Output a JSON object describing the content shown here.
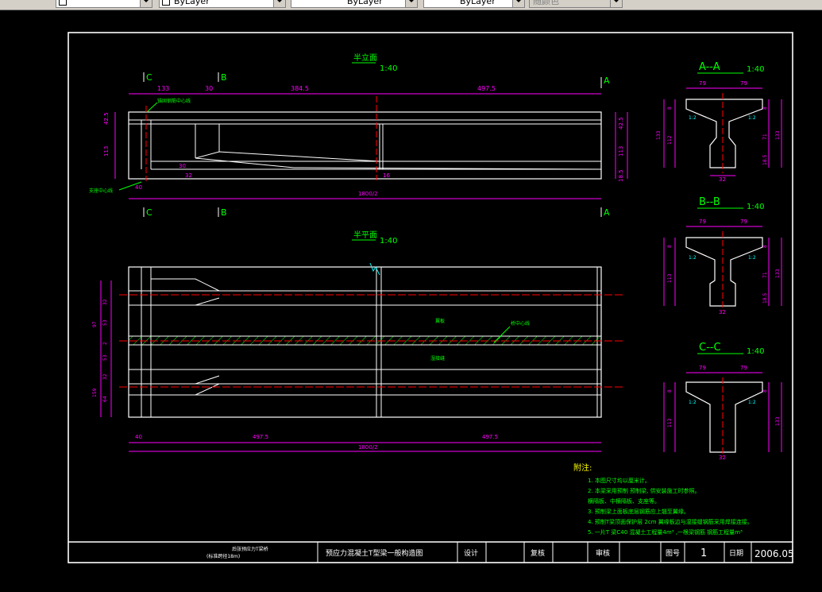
{
  "toolbar": {
    "layer_control": "",
    "color_control": "ByLayer",
    "linetype_control": "ByLayer",
    "lineweight_control": "ByLayer",
    "plotstyle_control": "随颜色"
  },
  "drawing": {
    "elevation_title": "半立面",
    "elevation_scale": "1:40",
    "plan_title": "半平面",
    "plan_scale": "1:40",
    "section_labels": {
      "A": "A",
      "B": "B",
      "C": "C"
    },
    "elevation_dims": {
      "top": [
        "133",
        "30",
        "384.5",
        "497.5"
      ],
      "left": [
        "42.5",
        "113"
      ],
      "right": [
        "42.5",
        "113",
        "18.5"
      ],
      "total": "1800/2",
      "near_left": "40",
      "small": [
        "30",
        "32",
        "16"
      ]
    },
    "elevation_annotations": {
      "anchor": "锚固钢筋中心线",
      "support": "支座中心线"
    },
    "plan_dims": {
      "bottom": [
        "40",
        "497.5",
        "497.5"
      ],
      "total": "1800/2",
      "left": [
        "32",
        "53",
        "2",
        "53",
        "32",
        "64"
      ],
      "left_total": [
        "97",
        "159"
      ]
    },
    "plan_annotations": {
      "flange": "翼板",
      "axis": "桥中心线",
      "wet_joint": "湿接缝"
    },
    "sections": [
      {
        "title": "A--A",
        "scale": "1:40",
        "dims": {
          "top": [
            "79",
            "79"
          ],
          "width": "32",
          "left": [
            "8",
            "112",
            "133"
          ],
          "right": [
            "8",
            "71",
            "18.5",
            "133"
          ],
          "taper": [
            "1:2",
            "1:2"
          ]
        }
      },
      {
        "title": "B--B",
        "scale": "1:40",
        "dims": {
          "top": [
            "79",
            "79"
          ],
          "width": "32",
          "left": [
            "8",
            "113"
          ],
          "right": [
            "8",
            "71",
            "18.5",
            "133"
          ],
          "taper": [
            "1:2",
            "1:2"
          ]
        }
      },
      {
        "title": "C--C",
        "scale": "1:40",
        "dims": {
          "top": [
            "79",
            "79"
          ],
          "width": "32",
          "left": [
            "8",
            "113"
          ],
          "right": [
            "8",
            "133"
          ],
          "taper": [
            "1:2",
            "1:2"
          ]
        }
      }
    ],
    "notes": {
      "heading": "附注:",
      "items": [
        "1. 本图尺寸均以厘米计。",
        "2. 本梁采用预制  预制梁, 供安装施工时参照。",
        "   横隔板、中横隔板、支座等。",
        "3. 预制梁上面板底层钢筋应上翘至翼缘。",
        "4. 预制T梁顶面保护层    2cm  翼缘板边与湿接缝钢筋采用焊接连接。",
        "5. 一片T  梁C40    混凝土工程量4m³       ,一根梁钢筋      钢筋工程量m³"
      ]
    },
    "title_block": {
      "project_line1": "后张预应力T梁桥",
      "project_line2": "(标准跨径18m)",
      "drawing_name": "预应力混凝土T型梁一般构造图",
      "designer_label": "设计",
      "checker_label": "复核",
      "reviewer_label": "审核",
      "drawing_no_label": "图号",
      "drawing_no": "1",
      "date_label": "日期",
      "date": "2006.05"
    }
  },
  "colors": {
    "background": "#000000",
    "frame": "#ffffff",
    "dimension": "#ff00ff",
    "title": "#00ff00",
    "centerline": "#ff0000",
    "annotation": "#00ff00",
    "hatch": "#00ff00",
    "section_mark": "#00ff00"
  }
}
